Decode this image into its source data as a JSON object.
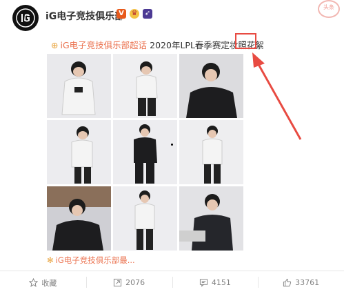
{
  "post": {
    "username": "iG电子竞技俱乐部",
    "topic_super": "iG电子竞技俱乐部超话",
    "description": "2020年LPL春季赛定妆照花絮",
    "source": "iG电子竞技俱乐部最...",
    "stamp": "头条"
  },
  "actions": {
    "favorite": "收藏",
    "repost": "2076",
    "comment": "4151",
    "like": "33761"
  },
  "colors": {
    "accent": "#eb7350",
    "highlight": "#e84b42",
    "muted": "#808080"
  },
  "icons": [
    "ig-logo-icon",
    "verified-v-icon",
    "crown-icon",
    "rocket-icon",
    "topic-icon",
    "star-icon",
    "repost-icon",
    "comment-icon",
    "like-icon"
  ]
}
